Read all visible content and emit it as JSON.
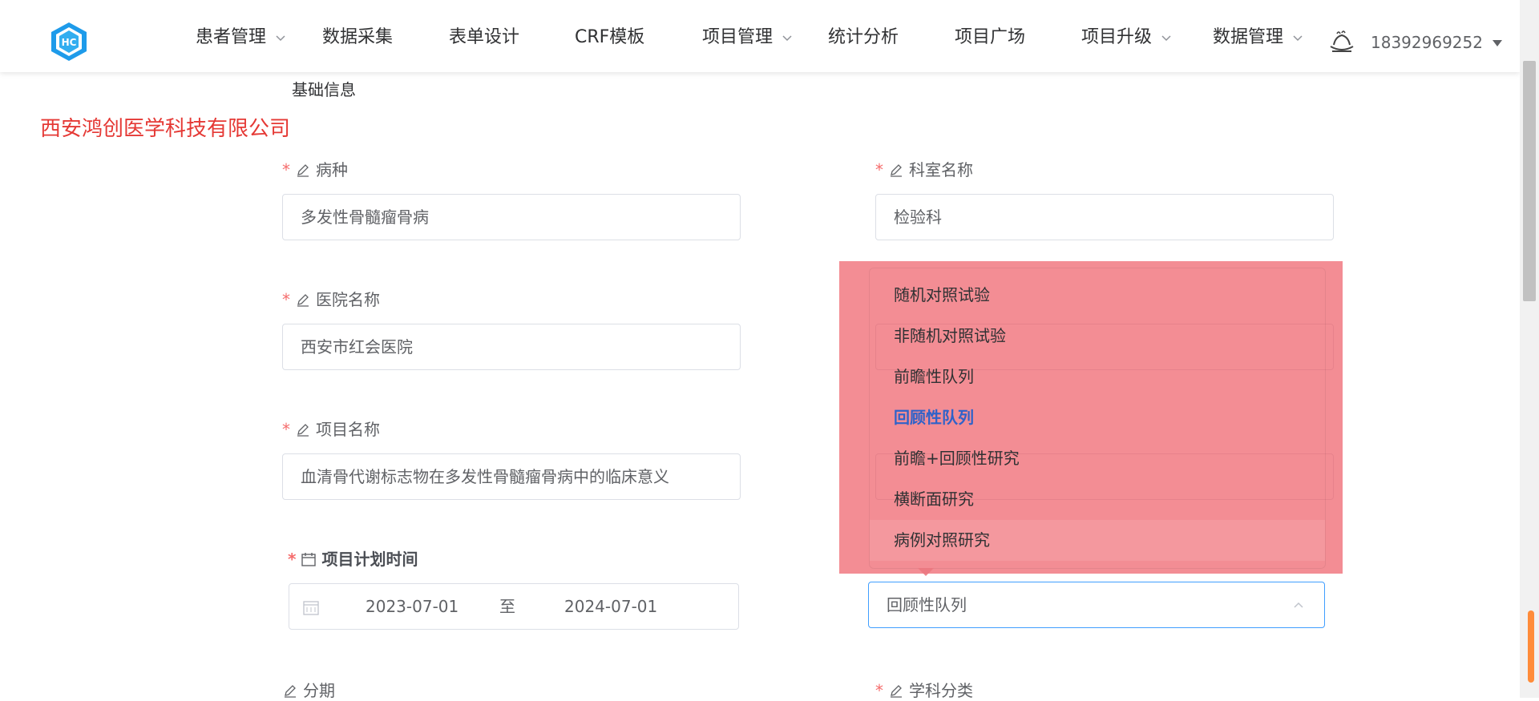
{
  "header": {
    "nav": [
      {
        "label": "患者管理",
        "has_dropdown": true
      },
      {
        "label": "数据采集",
        "has_dropdown": false
      },
      {
        "label": "表单设计",
        "has_dropdown": false
      },
      {
        "label": "CRF模板",
        "has_dropdown": false
      },
      {
        "label": "项目管理",
        "has_dropdown": true
      },
      {
        "label": "统计分析",
        "has_dropdown": false
      },
      {
        "label": "项目广场",
        "has_dropdown": false
      },
      {
        "label": "项目升级",
        "has_dropdown": true
      },
      {
        "label": "数据管理",
        "has_dropdown": true
      }
    ],
    "user": {
      "name": "18392969252"
    },
    "logo_text": "HC"
  },
  "page": {
    "section_title": "基础信息",
    "watermark": "西安鸿创医学科技有限公司"
  },
  "form": {
    "disease": {
      "label": "病种",
      "value": "多发性骨髓瘤骨病",
      "required": true
    },
    "department": {
      "label": "科室名称",
      "value": "检验科",
      "required": true
    },
    "hospital": {
      "label": "医院名称",
      "value": "西安市红会医院",
      "required": true
    },
    "project": {
      "label": "项目名称",
      "value": "血清骨代谢标志物在多发性骨髓瘤骨病中的临床意义",
      "required": true
    },
    "plan_time": {
      "label": "项目计划时间",
      "start": "2023-07-01",
      "separator": "至",
      "end": "2024-07-01",
      "required": true
    },
    "study_type": {
      "value": "回顾性队列"
    },
    "stage": {
      "label": "分期",
      "required": false
    },
    "discipline": {
      "label": "学科分类",
      "required": true
    }
  },
  "dropdown": {
    "options": [
      "随机对照试验",
      "非随机对照试验",
      "前瞻性队列",
      "回顾性队列",
      "前瞻+回顾性研究",
      "横断面研究",
      "病例对照研究"
    ],
    "selected": "回顾性队列"
  },
  "colors": {
    "required_asterisk": "#f56c6c",
    "watermark": "#e53935",
    "highlight_overlay": "#ec505a",
    "selected_option": "#2f62c9",
    "focus_border": "#409eff"
  }
}
